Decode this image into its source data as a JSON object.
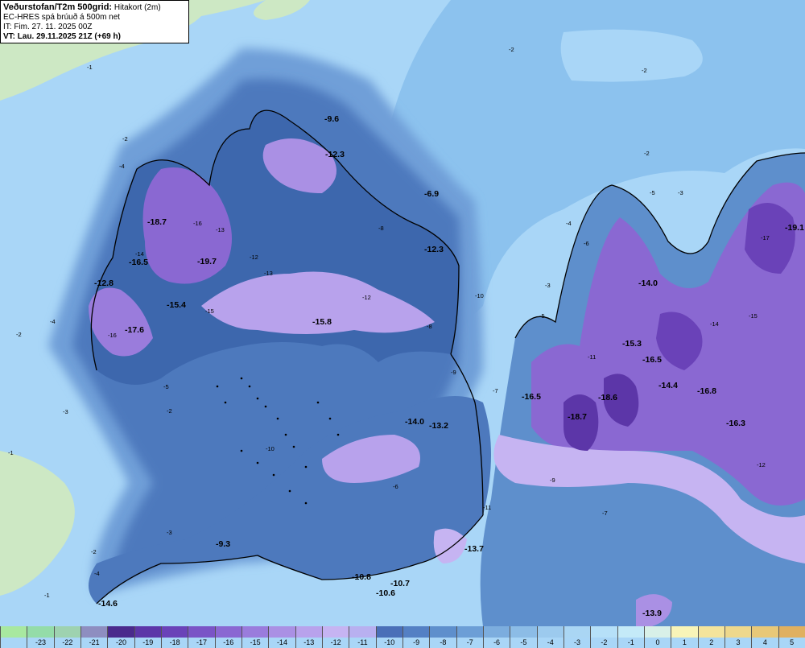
{
  "header": {
    "title_bold": "Veðurstofan/T2m 500grid:",
    "title_rest": "Hitakort (2m)",
    "model": "EC-HRES spá brúuð á 500m net",
    "init_time": "IT: Fim. 27. 11. 2025 00Z",
    "valid_time": "VT: Lau. 29.11.2025 21Z (+69 h)"
  },
  "colors": {
    "sea": "#a9d6f7",
    "sea_deep": "#8cc2ee",
    "land_green": "#cde8c4",
    "coast": "#000000"
  },
  "map_labels": {
    "bold_values": [
      "-9.6",
      "-12.3",
      "-6.9",
      "-18.7",
      "-16.5",
      "-19.7",
      "-12.3",
      "-12.8",
      "-15.4",
      "-17.6",
      "-15.8",
      "-14.0",
      "-15.3",
      "-16.5",
      "-14.4",
      "-16.8",
      "-16.5",
      "-18.6",
      "-18.7",
      "-16.3",
      "-19.1",
      "-14.0",
      "-13.2",
      "-13.7",
      "-10.8",
      "-10.7",
      "-10.6",
      "-9.3",
      "-14.6",
      "-13.9"
    ],
    "contour_values": [
      "-1",
      "-2",
      "-3",
      "-4",
      "-5",
      "-6",
      "-7",
      "-8",
      "-9",
      "-10",
      "-11",
      "-12",
      "-13",
      "-14",
      "-15",
      "-16",
      "-17"
    ]
  },
  "colorbar": {
    "labels": [
      "",
      "-23",
      "-22",
      "-21",
      "-20",
      "-19",
      "-18",
      "-17",
      "-16",
      "-15",
      "-14",
      "-13",
      "-12",
      "-11",
      "-10",
      "-9",
      "-8",
      "-7",
      "-6",
      "-5",
      "-4",
      "-3",
      "-2",
      "-1",
      "0",
      "1",
      "2",
      "3",
      "4",
      "5"
    ],
    "colors": [
      "#a8e8a0",
      "#94dca8",
      "#9ed2b0",
      "#8e8ec0",
      "#4a2a8c",
      "#5c36a8",
      "#6a42b8",
      "#7a54c6",
      "#8a68d2",
      "#9a7cdc",
      "#aa90e4",
      "#b8a2ec",
      "#c6b4f2",
      "#b8b0f0",
      "#4a6fb8",
      "#5480c4",
      "#5e8fcc",
      "#6c9ed6",
      "#7cadde",
      "#8cbce6",
      "#9ccaee",
      "#aad6f4",
      "#b6e0f8",
      "#c4eaf8",
      "#d8f0e8",
      "#f8f4b8",
      "#f4e49c",
      "#eed88c",
      "#e8c878",
      "#e0b060"
    ]
  }
}
